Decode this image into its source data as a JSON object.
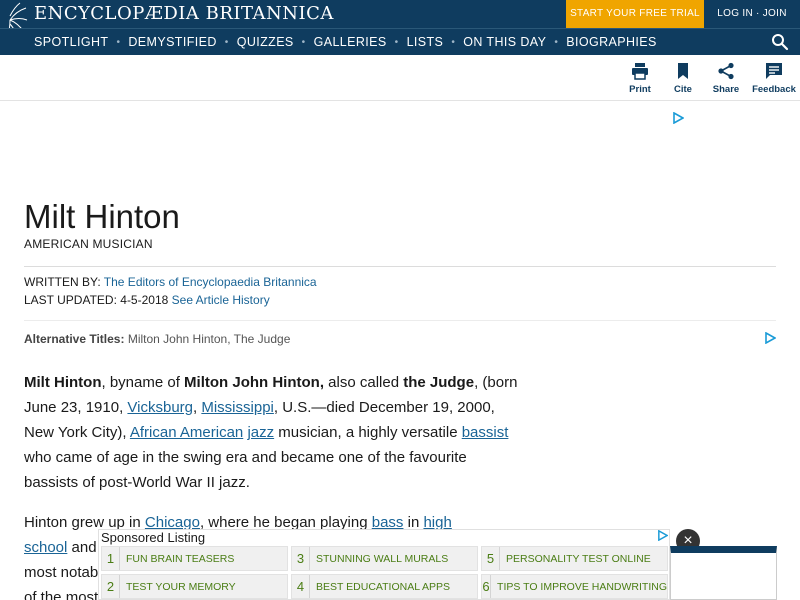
{
  "header": {
    "brand": "ENCYCLOPÆDIA BRITANNICA",
    "trial_label": "START YOUR FREE TRIAL",
    "login_label": "LOG IN · JOIN"
  },
  "nav": {
    "items": [
      "SPOTLIGHT",
      "DEMYSTIFIED",
      "QUIZZES",
      "GALLERIES",
      "LISTS",
      "ON THIS DAY",
      "BIOGRAPHIES"
    ],
    "separator": "•"
  },
  "tools": {
    "print": "Print",
    "cite": "Cite",
    "share": "Share",
    "feedback": "Feedback"
  },
  "article": {
    "title": "Milt Hinton",
    "subtitle": "AMERICAN MUSICIAN",
    "written_by_label": "WRITTEN BY:",
    "written_by": "The Editors of Encyclopaedia Britannica",
    "updated_label": "LAST UPDATED:",
    "updated_date": "4-5-2018",
    "history_link": "See Article History",
    "alt_label": "Alternative Titles:",
    "alt_titles": "Milton John Hinton, The Judge",
    "p1": {
      "name": "Milt Hinton",
      "t1": ", byname of ",
      "fullname": "Milton John Hinton,",
      "t2": " also called ",
      "nickname": "the Judge",
      "t3": ", (born June 23, 1910, ",
      "l_vicksburg": "Vicksburg",
      "t4": ", ",
      "l_mississippi": "Mississippi",
      "t5": ", U.S.—died December 19, 2000, New York City), ",
      "l_african_american": "African American",
      "t6": " ",
      "l_jazz": "jazz",
      "t7": " musician, a highly versatile ",
      "l_bassist": "bassist",
      "t8": " who came of age in the swing era and became one of the favourite bassists of post-World War II jazz."
    },
    "p2": {
      "t1": "Hinton grew up in ",
      "l_chicago": "Chicago",
      "t2": ", where he began playing ",
      "l_bass": "bass",
      "t3": " in ",
      "l_high_school": "high school",
      "t4": " and",
      "line3": "most notab",
      "line4": "of the most"
    }
  },
  "sponsored": {
    "title": "Sponsored Listing",
    "items": [
      {
        "num": "1",
        "text": "FUN BRAIN TEASERS"
      },
      {
        "num": "3",
        "text": "STUNNING WALL MURALS"
      },
      {
        "num": "5",
        "text": "PERSONALITY TEST ONLINE"
      },
      {
        "num": "2",
        "text": "TEST YOUR MEMORY"
      },
      {
        "num": "4",
        "text": "BEST EDUCATIONAL APPS"
      },
      {
        "num": "6",
        "text": "TIPS TO IMPROVE HANDWRITING"
      }
    ],
    "close_symbol": "×"
  },
  "colors": {
    "navy": "#0f3c5f",
    "accent": "#f0a500",
    "link": "#1a6496",
    "sponsor_text": "#4a7d14"
  }
}
